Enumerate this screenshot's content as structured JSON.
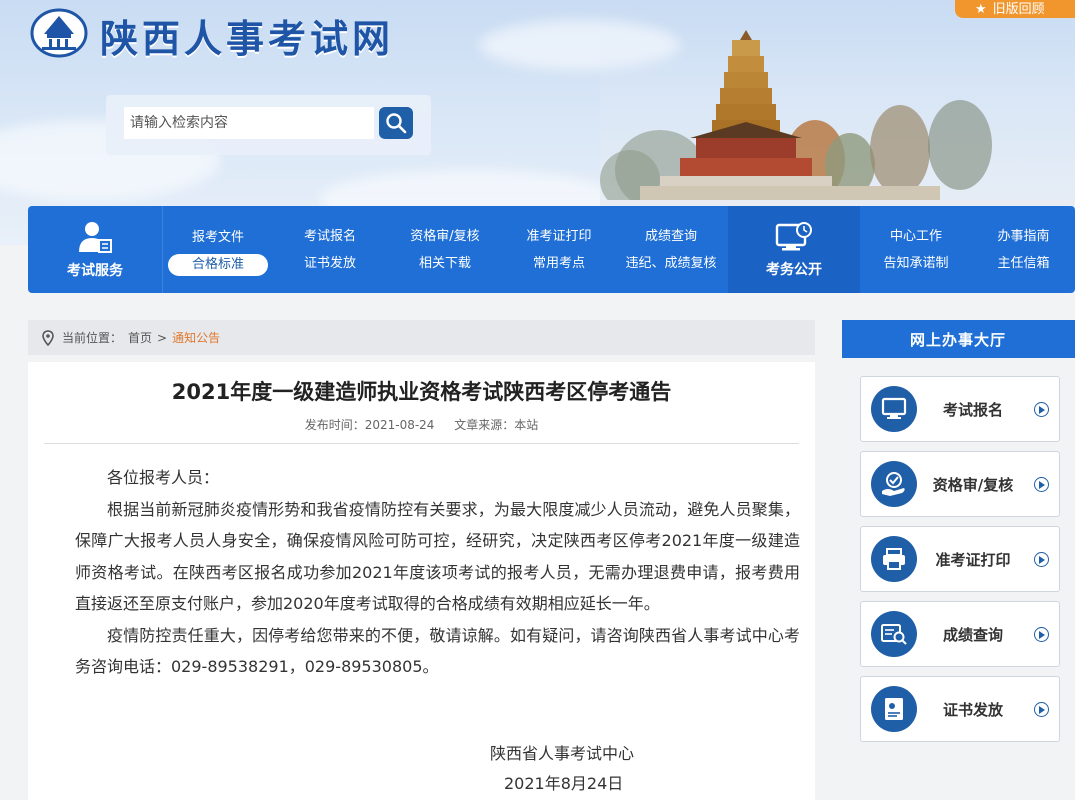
{
  "header": {
    "site_title": "陕西人事考试网",
    "old_version_label": "旧版回顾",
    "search_placeholder": "请输入检索内容"
  },
  "nav": {
    "service_label": "考试服务",
    "public_label": "考务公开",
    "columns": [
      {
        "top": "报考文件",
        "bottom": "合格标准"
      },
      {
        "top": "考试报名",
        "bottom": "证书发放"
      },
      {
        "top": "资格审/复核",
        "bottom": "相关下载"
      },
      {
        "top": "准考证打印",
        "bottom": "常用考点"
      },
      {
        "top": "成绩查询",
        "bottom": "违纪、成绩复核"
      },
      {
        "top": "中心工作",
        "bottom": "告知承诺制"
      },
      {
        "top": "办事指南",
        "bottom": "主任信箱"
      }
    ]
  },
  "breadcrumb": {
    "prefix": "当前位置：",
    "home": "首页",
    "sep": ">",
    "current": "通知公告"
  },
  "article": {
    "title": "2021年度一级建造师执业资格考试陕西考区停考通告",
    "publish_label": "发布时间：2021-08-24",
    "source_label": "文章来源：本站",
    "greeting": "各位报考人员：",
    "para1": "根据当前新冠肺炎疫情形势和我省疫情防控有关要求，为最大限度减少人员流动，避免人员聚集，保障广大报考人员人身安全，确保疫情风险可防可控，经研究，决定陕西考区停考2021年度一级建造师资格考试。在陕西考区报名成功参加2021年度该项考试的报考人员，无需办理退费申请，报考费用直接返还至原支付账户，参加2020年度考试取得的合格成绩有效期相应延长一年。",
    "para2": "疫情防控责任重大，因停考给您带来的不便，敬请谅解。如有疑问，请咨询陕西省人事考试中心考务咨询电话：029-89538291，029-89530805。",
    "signature_org": "陕西省人事考试中心",
    "signature_date": "2021年8月24日"
  },
  "sidebar": {
    "title": "网上办事大厅",
    "items": [
      {
        "label": "考试报名",
        "icon": "monitor-icon"
      },
      {
        "label": "资格审/复核",
        "icon": "hand-check-icon"
      },
      {
        "label": "准考证打印",
        "icon": "printer-icon"
      },
      {
        "label": "成绩查询",
        "icon": "score-search-icon"
      },
      {
        "label": "证书发放",
        "icon": "certificate-icon"
      }
    ]
  },
  "colors": {
    "primary": "#1f6fd6",
    "dark_blue": "#1f5fa8",
    "accent_orange": "#e0782d"
  }
}
